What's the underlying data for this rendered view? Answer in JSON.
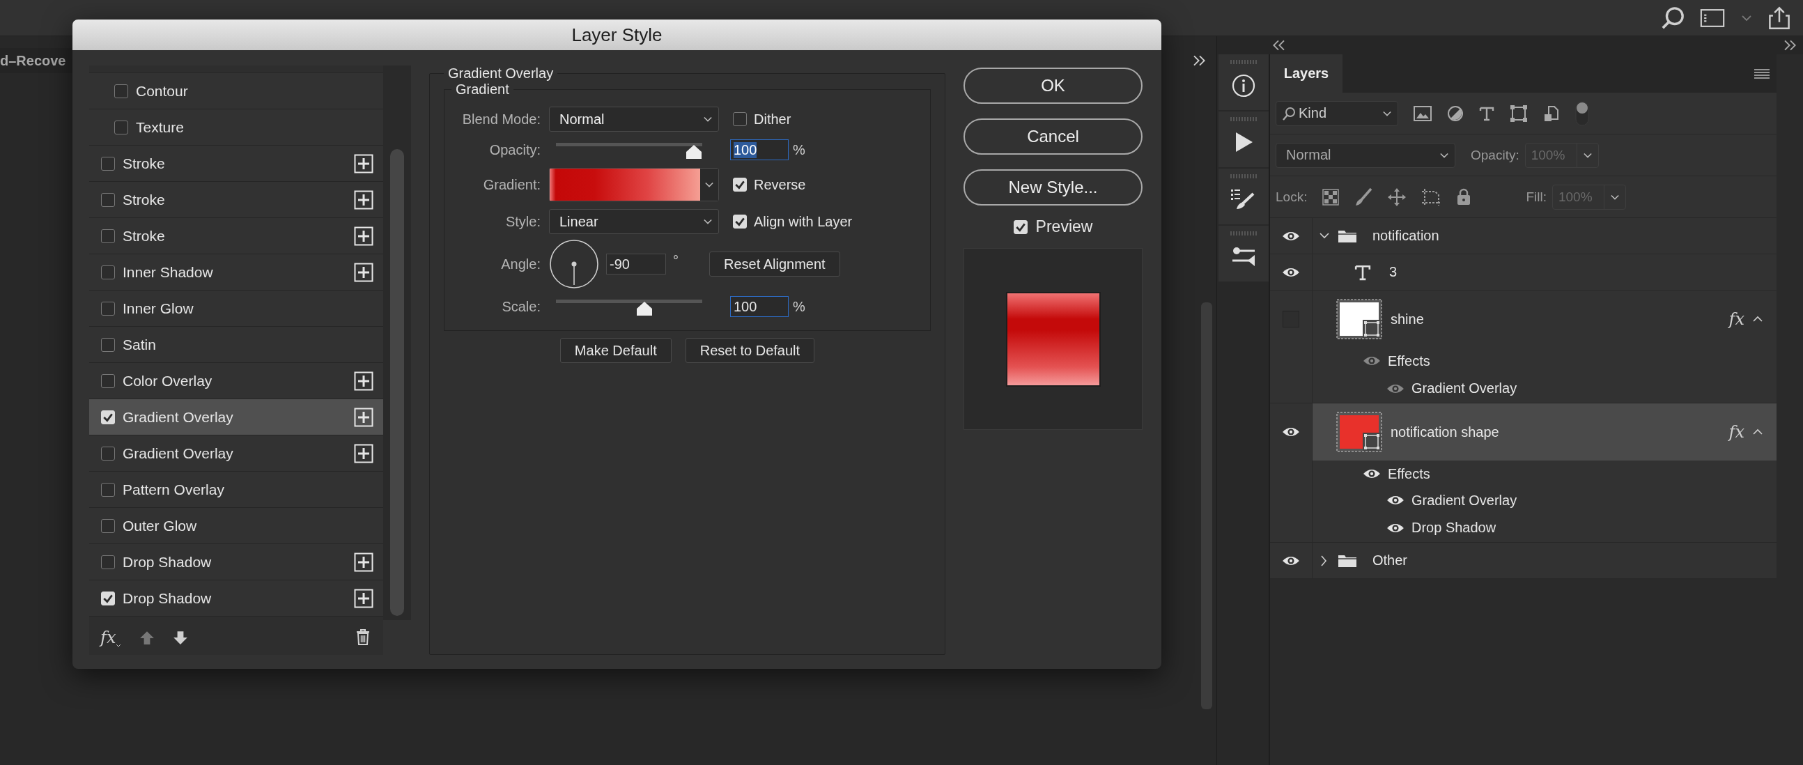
{
  "document_tab": {
    "title": "d–Recove"
  },
  "dialog": {
    "title": "Layer Style",
    "styles": [
      {
        "label": "Contour",
        "kind": "sub",
        "checked": false,
        "selected": false,
        "addable": false
      },
      {
        "label": "Texture",
        "kind": "sub",
        "checked": false,
        "selected": false,
        "addable": false
      },
      {
        "label": "Stroke",
        "kind": "main",
        "checked": false,
        "selected": false,
        "addable": true
      },
      {
        "label": "Stroke",
        "kind": "main",
        "checked": false,
        "selected": false,
        "addable": true
      },
      {
        "label": "Stroke",
        "kind": "main",
        "checked": false,
        "selected": false,
        "addable": true
      },
      {
        "label": "Inner Shadow",
        "kind": "main",
        "checked": false,
        "selected": false,
        "addable": true
      },
      {
        "label": "Inner Glow",
        "kind": "main",
        "checked": false,
        "selected": false,
        "addable": false
      },
      {
        "label": "Satin",
        "kind": "main",
        "checked": false,
        "selected": false,
        "addable": false
      },
      {
        "label": "Color Overlay",
        "kind": "main",
        "checked": false,
        "selected": false,
        "addable": true
      },
      {
        "label": "Gradient Overlay",
        "kind": "main",
        "checked": true,
        "selected": true,
        "addable": true
      },
      {
        "label": "Gradient Overlay",
        "kind": "main",
        "checked": false,
        "selected": false,
        "addable": true
      },
      {
        "label": "Pattern Overlay",
        "kind": "main",
        "checked": false,
        "selected": false,
        "addable": false
      },
      {
        "label": "Outer Glow",
        "kind": "main",
        "checked": false,
        "selected": false,
        "addable": false
      },
      {
        "label": "Drop Shadow",
        "kind": "main",
        "checked": false,
        "selected": false,
        "addable": true
      },
      {
        "label": "Drop Shadow",
        "kind": "main",
        "checked": true,
        "selected": false,
        "addable": true
      }
    ],
    "footer": {
      "fx": "fx"
    },
    "panel": {
      "title": "Gradient Overlay",
      "group": "Gradient",
      "blend_mode": {
        "label": "Blend Mode:",
        "value": "Normal"
      },
      "dither": {
        "label": "Dither",
        "checked": false
      },
      "opacity": {
        "label": "Opacity:",
        "level": 1,
        "value": "100",
        "unit": "%",
        "text_selected": true
      },
      "gradient": {
        "label": "Gradient:"
      },
      "reverse": {
        "label": "Reverse",
        "checked": true
      },
      "style": {
        "label": "Style:",
        "value": "Linear"
      },
      "align_with_layer": {
        "label": "Align with Layer",
        "checked": true
      },
      "angle": {
        "label": "Angle:",
        "value": "-90",
        "unit": "°"
      },
      "reset_alignment": "Reset Alignment",
      "scale": {
        "label": "Scale:",
        "level": 0.62,
        "value": "100",
        "unit": "%"
      },
      "buttons": [
        "Make Default",
        "Reset to Default"
      ]
    },
    "actions": [
      "OK",
      "Cancel",
      "New Style..."
    ],
    "preview": {
      "label": "Preview",
      "checked": true
    }
  },
  "layers_panel": {
    "title": "Layers",
    "filter": {
      "value": "Kind",
      "on": true
    },
    "blend_mode": {
      "value": "Normal"
    },
    "opacity": {
      "label": "Opacity:",
      "value": "100%",
      "disabled": true
    },
    "lock": {
      "label": "Lock:"
    },
    "fill": {
      "label": "Fill:",
      "value": "100%",
      "disabled": true
    },
    "layers": [
      {
        "kind": "group",
        "name": "notification",
        "visible": true,
        "expanded": true,
        "selected": false,
        "children": [
          {
            "kind": "text",
            "name": "3",
            "visible": true,
            "selected": false
          },
          {
            "kind": "shape",
            "name": "shine",
            "visible": false,
            "selected": false,
            "color": "#ffffff",
            "fx": "fx",
            "effects": {
              "label": "Effects",
              "children": [
                {
                  "name": "Gradient Overlay"
                }
              ]
            }
          },
          {
            "kind": "shape",
            "name": "notification shape",
            "visible": true,
            "selected": true,
            "color": "#e8312b",
            "fx": "fx",
            "effects": {
              "label": "Effects",
              "children": [
                {
                  "name": "Gradient Overlay"
                },
                {
                  "name": "Drop Shadow"
                }
              ]
            }
          }
        ]
      },
      {
        "kind": "group",
        "name": "Other",
        "visible": true,
        "expanded": false,
        "selected": false
      }
    ]
  }
}
